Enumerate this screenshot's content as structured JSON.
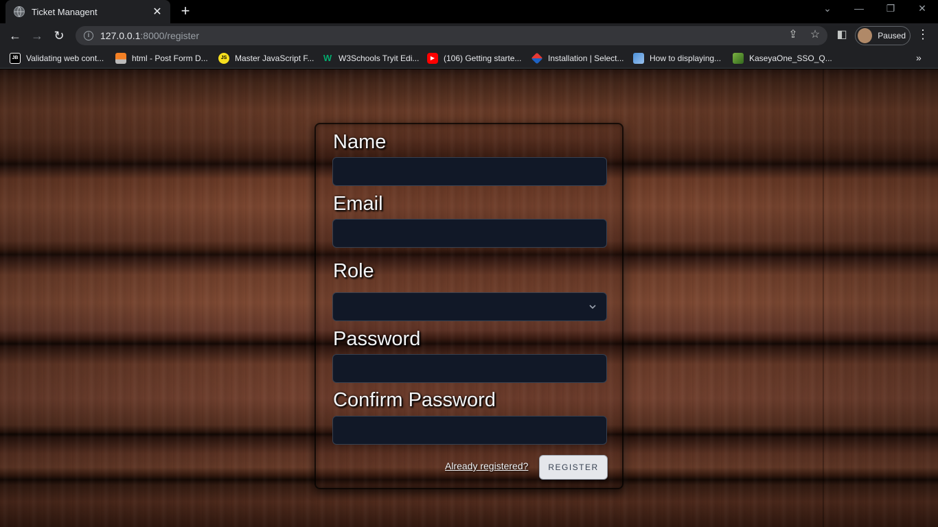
{
  "browser": {
    "tab_title": "Ticket Managent",
    "tab_close": "✕",
    "new_tab": "+",
    "url_host": "127.0.0.1",
    "url_path": ":8000/register",
    "profile_status": "Paused",
    "bookmarks": [
      {
        "label": "Validating web cont...",
        "icon": "jb-icon",
        "color": "#000000"
      },
      {
        "label": "html - Post Form D...",
        "icon": "stackoverflow-icon",
        "color": "#f48024"
      },
      {
        "label": "Master JavaScript F...",
        "icon": "js-icon",
        "color": "#f7df1e"
      },
      {
        "label": "W3Schools Tryit Edi...",
        "icon": "w3schools-icon",
        "color": "#04aa6d"
      },
      {
        "label": "(106) Getting starte...",
        "icon": "youtube-icon",
        "color": "#ff0000"
      },
      {
        "label": "Installation | Select...",
        "icon": "select2-icon",
        "color": "#e53935"
      },
      {
        "label": "How to displaying...",
        "icon": "laracasts-icon",
        "color": "#4a90d9"
      },
      {
        "label": "KaseyaOne_SSO_Q...",
        "icon": "kaseya-icon",
        "color": "#7cb342"
      }
    ],
    "bookmarks_more": "»"
  },
  "form": {
    "name_label": "Name",
    "name_value": "",
    "email_label": "Email",
    "email_value": "",
    "role_label": "Role",
    "role_value": "",
    "password_label": "Password",
    "password_value": "",
    "confirm_password_label": "Confirm Password",
    "confirm_password_value": "",
    "login_link": "Already registered?",
    "register_button": "REGISTER"
  },
  "colors": {
    "input_bg": "#111827",
    "label_text": "#f3f4f6",
    "button_bg": "#e5e7eb"
  }
}
